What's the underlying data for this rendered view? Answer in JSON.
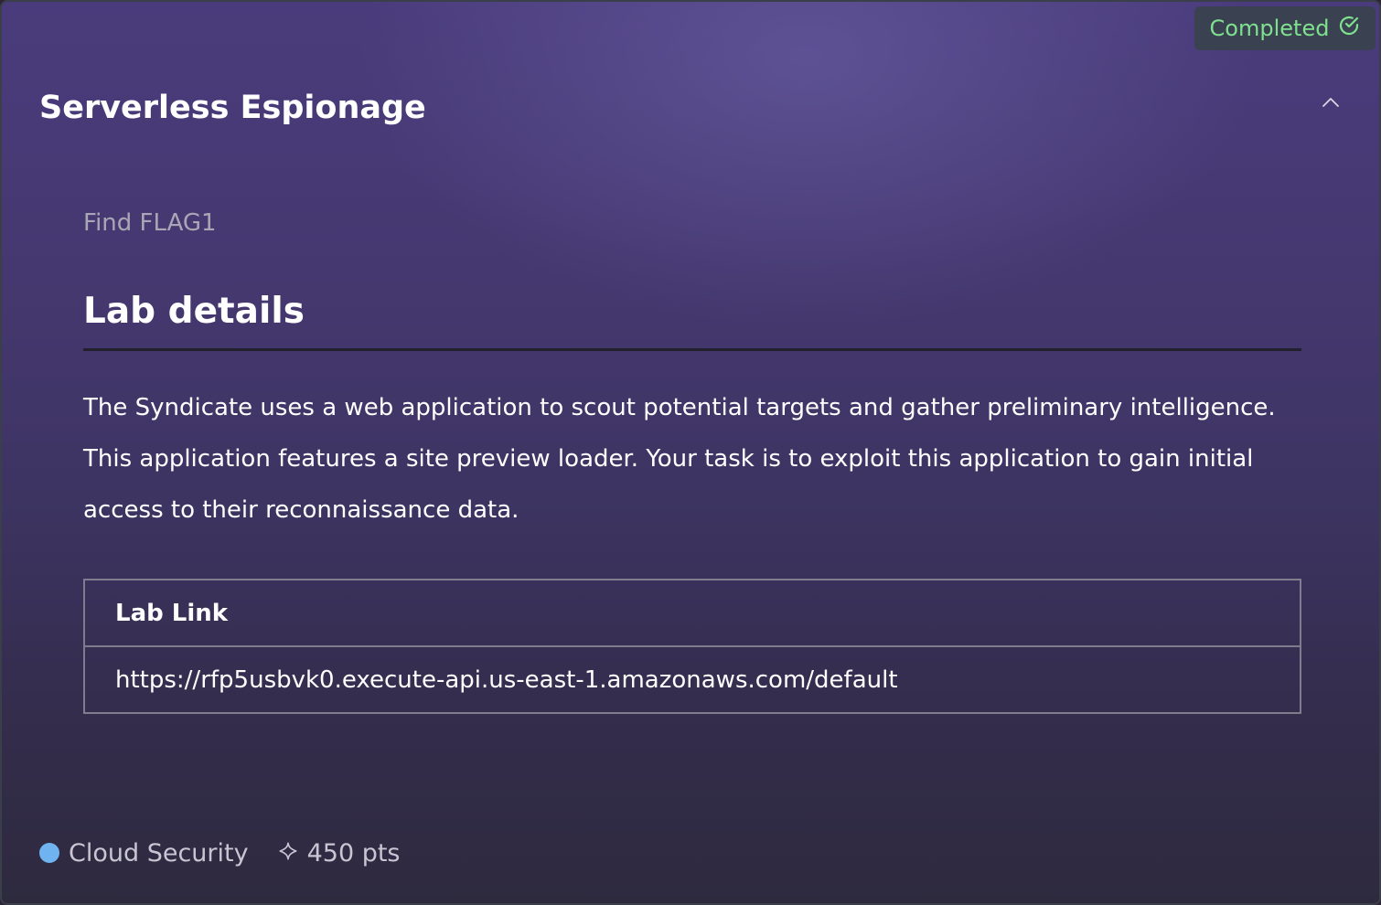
{
  "status": {
    "label": "Completed",
    "icon": "check-circle-icon",
    "color": "#7fe08e"
  },
  "challenge": {
    "title": "Serverless Espionage",
    "subtitle": "Find FLAG1"
  },
  "lab_details": {
    "heading": "Lab details",
    "description": "The Syndicate uses a web application to scout potential targets and gather preliminary intelligence. This application features a site preview loader. Your task is to exploit this application to gain initial access to their reconnaissance data.",
    "table": {
      "header": "Lab Link",
      "link": "https://rfp5usbvk0.execute-api.us-east-1.amazonaws.com/default"
    }
  },
  "footer": {
    "category": "Cloud Security",
    "category_color": "#6fb3f0",
    "points": "450 pts",
    "points_icon": "sparkle-icon"
  }
}
